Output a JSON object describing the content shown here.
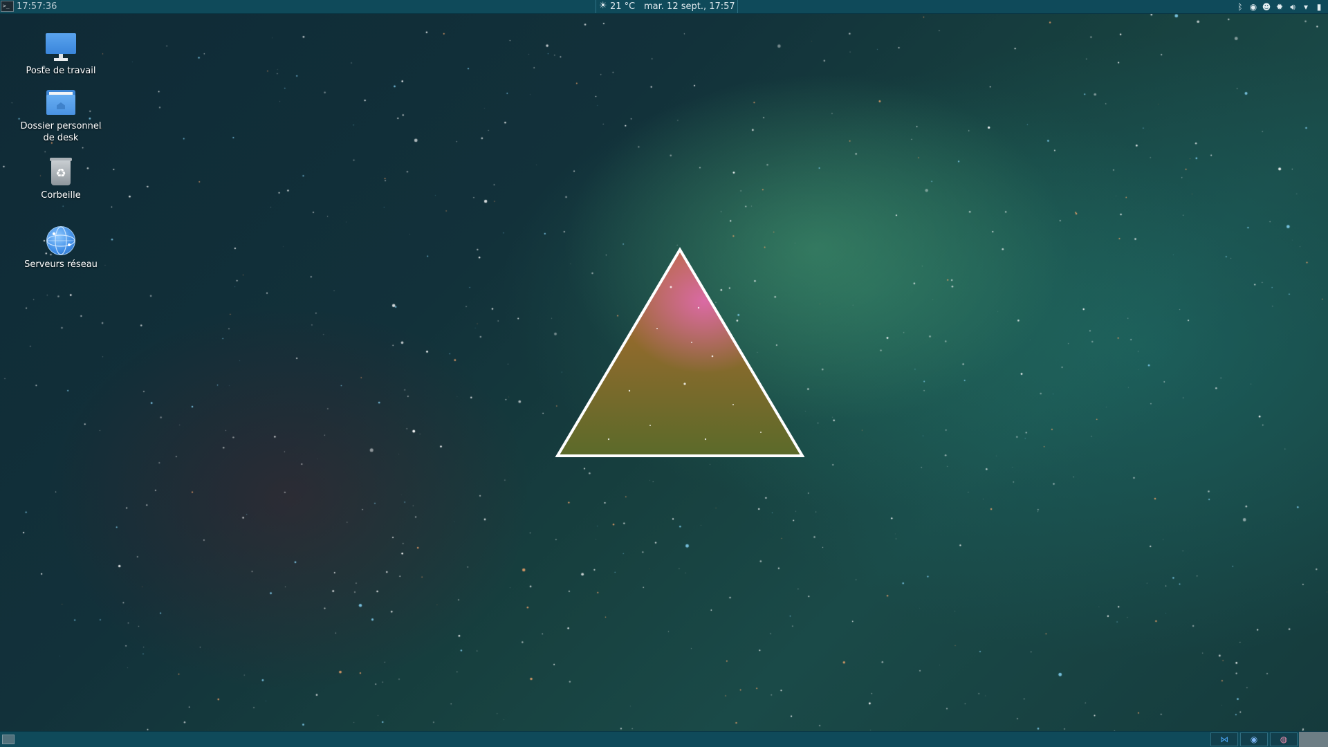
{
  "top_panel": {
    "clock": "17:57:36",
    "weather": "21 °C",
    "date": "mar. 12 sept., 17:57",
    "tray_icons": [
      "bluetooth-icon",
      "chrome-icon",
      "discord-icon",
      "settings-icon",
      "volume-icon",
      "wifi-icon",
      "battery-icon"
    ]
  },
  "desktop": {
    "icons": [
      {
        "label": "Poste de travail",
        "icon": "computer-icon"
      },
      {
        "label": "Dossier personnel\nde desk",
        "icon": "home-folder-icon"
      },
      {
        "label": "Corbeille",
        "icon": "trash-icon"
      },
      {
        "label": "Serveurs réseau",
        "icon": "network-globe-icon"
      }
    ]
  },
  "taskbar": {
    "apps": [
      "vscode-icon",
      "chrome-icon",
      "app-icon"
    ]
  },
  "colors": {
    "panel": "#0f4a5a",
    "triangle_outline": "#ffffff"
  }
}
